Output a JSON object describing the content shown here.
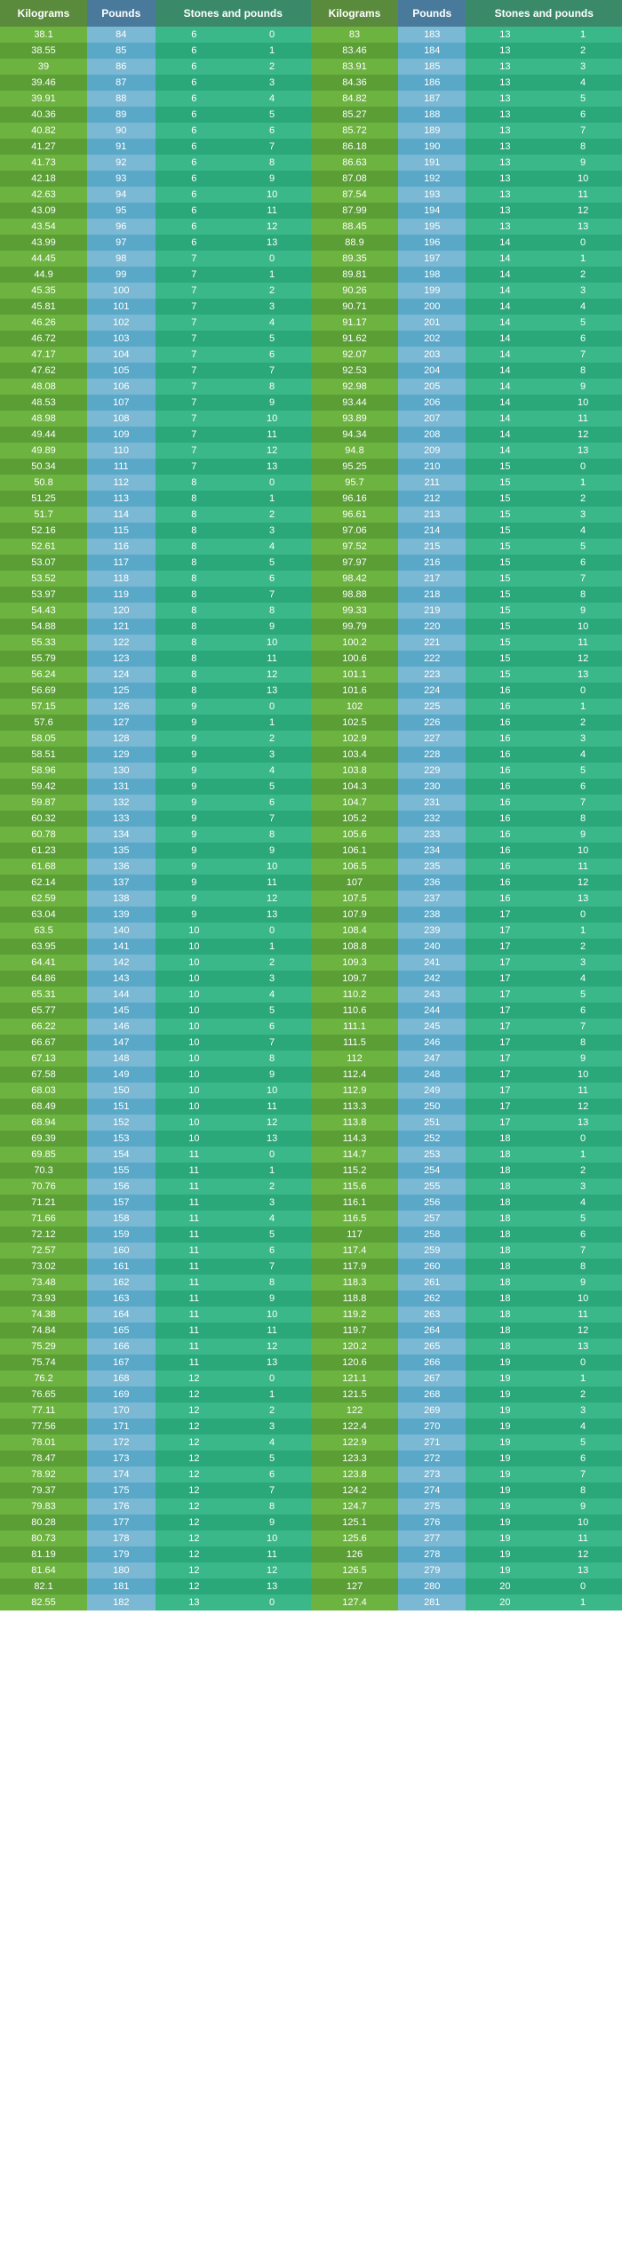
{
  "headers": {
    "kg": "Kilograms",
    "lbs": "Pounds",
    "st": "Stones and pounds"
  },
  "rows": [
    [
      38.1,
      84,
      6,
      0,
      83.0,
      183,
      13,
      1
    ],
    [
      38.55,
      85,
      6,
      1,
      83.46,
      184,
      13,
      2
    ],
    [
      39.0,
      86,
      6,
      2,
      83.91,
      185,
      13,
      3
    ],
    [
      39.46,
      87,
      6,
      3,
      84.36,
      186,
      13,
      4
    ],
    [
      39.91,
      88,
      6,
      4,
      84.82,
      187,
      13,
      5
    ],
    [
      40.36,
      89,
      6,
      5,
      85.27,
      188,
      13,
      6
    ],
    [
      40.82,
      90,
      6,
      6,
      85.72,
      189,
      13,
      7
    ],
    [
      41.27,
      91,
      6,
      7,
      86.18,
      190,
      13,
      8
    ],
    [
      41.73,
      92,
      6,
      8,
      86.63,
      191,
      13,
      9
    ],
    [
      42.18,
      93,
      6,
      9,
      87.08,
      192,
      13,
      10
    ],
    [
      42.63,
      94,
      6,
      10,
      87.54,
      193,
      13,
      11
    ],
    [
      43.09,
      95,
      6,
      11,
      87.99,
      194,
      13,
      12
    ],
    [
      43.54,
      96,
      6,
      12,
      88.45,
      195,
      13,
      13
    ],
    [
      43.99,
      97,
      6,
      13,
      88.9,
      196,
      14,
      0
    ],
    [
      44.45,
      98,
      7,
      0,
      89.35,
      197,
      14,
      1
    ],
    [
      44.9,
      99,
      7,
      1,
      89.81,
      198,
      14,
      2
    ],
    [
      45.35,
      100,
      7,
      2,
      90.26,
      199,
      14,
      3
    ],
    [
      45.81,
      101,
      7,
      3,
      90.71,
      200,
      14,
      4
    ],
    [
      46.26,
      102,
      7,
      4,
      91.17,
      201,
      14,
      5
    ],
    [
      46.72,
      103,
      7,
      5,
      91.62,
      202,
      14,
      6
    ],
    [
      47.17,
      104,
      7,
      6,
      92.07,
      203,
      14,
      7
    ],
    [
      47.62,
      105,
      7,
      7,
      92.53,
      204,
      14,
      8
    ],
    [
      48.08,
      106,
      7,
      8,
      92.98,
      205,
      14,
      9
    ],
    [
      48.53,
      107,
      7,
      9,
      93.44,
      206,
      14,
      10
    ],
    [
      48.98,
      108,
      7,
      10,
      93.89,
      207,
      14,
      11
    ],
    [
      49.44,
      109,
      7,
      11,
      94.34,
      208,
      14,
      12
    ],
    [
      49.89,
      110,
      7,
      12,
      94.8,
      209,
      14,
      13
    ],
    [
      50.34,
      111,
      7,
      13,
      95.25,
      210,
      15,
      0
    ],
    [
      50.8,
      112,
      8,
      0,
      95.7,
      211,
      15,
      1
    ],
    [
      51.25,
      113,
      8,
      1,
      96.16,
      212,
      15,
      2
    ],
    [
      51.7,
      114,
      8,
      2,
      96.61,
      213,
      15,
      3
    ],
    [
      52.16,
      115,
      8,
      3,
      97.06,
      214,
      15,
      4
    ],
    [
      52.61,
      116,
      8,
      4,
      97.52,
      215,
      15,
      5
    ],
    [
      53.07,
      117,
      8,
      5,
      97.97,
      216,
      15,
      6
    ],
    [
      53.52,
      118,
      8,
      6,
      98.42,
      217,
      15,
      7
    ],
    [
      53.97,
      119,
      8,
      7,
      98.88,
      218,
      15,
      8
    ],
    [
      54.43,
      120,
      8,
      8,
      99.33,
      219,
      15,
      9
    ],
    [
      54.88,
      121,
      8,
      9,
      99.79,
      220,
      15,
      10
    ],
    [
      55.33,
      122,
      8,
      10,
      100.2,
      221,
      15,
      11
    ],
    [
      55.79,
      123,
      8,
      11,
      100.6,
      222,
      15,
      12
    ],
    [
      56.24,
      124,
      8,
      12,
      101.1,
      223,
      15,
      13
    ],
    [
      56.69,
      125,
      8,
      13,
      101.6,
      224,
      16,
      0
    ],
    [
      57.15,
      126,
      9,
      0,
      102.0,
      225,
      16,
      1
    ],
    [
      57.6,
      127,
      9,
      1,
      102.5,
      226,
      16,
      2
    ],
    [
      58.05,
      128,
      9,
      2,
      102.9,
      227,
      16,
      3
    ],
    [
      58.51,
      129,
      9,
      3,
      103.4,
      228,
      16,
      4
    ],
    [
      58.96,
      130,
      9,
      4,
      103.8,
      229,
      16,
      5
    ],
    [
      59.42,
      131,
      9,
      5,
      104.3,
      230,
      16,
      6
    ],
    [
      59.87,
      132,
      9,
      6,
      104.7,
      231,
      16,
      7
    ],
    [
      60.32,
      133,
      9,
      7,
      105.2,
      232,
      16,
      8
    ],
    [
      60.78,
      134,
      9,
      8,
      105.6,
      233,
      16,
      9
    ],
    [
      61.23,
      135,
      9,
      9,
      106.1,
      234,
      16,
      10
    ],
    [
      61.68,
      136,
      9,
      10,
      106.5,
      235,
      16,
      11
    ],
    [
      62.14,
      137,
      9,
      11,
      107.0,
      236,
      16,
      12
    ],
    [
      62.59,
      138,
      9,
      12,
      107.5,
      237,
      16,
      13
    ],
    [
      63.04,
      139,
      9,
      13,
      107.9,
      238,
      17,
      0
    ],
    [
      63.5,
      140,
      10,
      0,
      108.4,
      239,
      17,
      1
    ],
    [
      63.95,
      141,
      10,
      1,
      108.8,
      240,
      17,
      2
    ],
    [
      64.41,
      142,
      10,
      2,
      109.3,
      241,
      17,
      3
    ],
    [
      64.86,
      143,
      10,
      3,
      109.7,
      242,
      17,
      4
    ],
    [
      65.31,
      144,
      10,
      4,
      110.2,
      243,
      17,
      5
    ],
    [
      65.77,
      145,
      10,
      5,
      110.6,
      244,
      17,
      6
    ],
    [
      66.22,
      146,
      10,
      6,
      111.1,
      245,
      17,
      7
    ],
    [
      66.67,
      147,
      10,
      7,
      111.5,
      246,
      17,
      8
    ],
    [
      67.13,
      148,
      10,
      8,
      112.0,
      247,
      17,
      9
    ],
    [
      67.58,
      149,
      10,
      9,
      112.4,
      248,
      17,
      10
    ],
    [
      68.03,
      150,
      10,
      10,
      112.9,
      249,
      17,
      11
    ],
    [
      68.49,
      151,
      10,
      11,
      113.3,
      250,
      17,
      12
    ],
    [
      68.94,
      152,
      10,
      12,
      113.8,
      251,
      17,
      13
    ],
    [
      69.39,
      153,
      10,
      13,
      114.3,
      252,
      18,
      0
    ],
    [
      69.85,
      154,
      11,
      0,
      114.7,
      253,
      18,
      1
    ],
    [
      70.3,
      155,
      11,
      1,
      115.2,
      254,
      18,
      2
    ],
    [
      70.76,
      156,
      11,
      2,
      115.6,
      255,
      18,
      3
    ],
    [
      71.21,
      157,
      11,
      3,
      116.1,
      256,
      18,
      4
    ],
    [
      71.66,
      158,
      11,
      4,
      116.5,
      257,
      18,
      5
    ],
    [
      72.12,
      159,
      11,
      5,
      117.0,
      258,
      18,
      6
    ],
    [
      72.57,
      160,
      11,
      6,
      117.4,
      259,
      18,
      7
    ],
    [
      73.02,
      161,
      11,
      7,
      117.9,
      260,
      18,
      8
    ],
    [
      73.48,
      162,
      11,
      8,
      118.3,
      261,
      18,
      9
    ],
    [
      73.93,
      163,
      11,
      9,
      118.8,
      262,
      18,
      10
    ],
    [
      74.38,
      164,
      11,
      10,
      119.2,
      263,
      18,
      11
    ],
    [
      74.84,
      165,
      11,
      11,
      119.7,
      264,
      18,
      12
    ],
    [
      75.29,
      166,
      11,
      12,
      120.2,
      265,
      18,
      13
    ],
    [
      75.74,
      167,
      11,
      13,
      120.6,
      266,
      19,
      0
    ],
    [
      76.2,
      168,
      12,
      0,
      121.1,
      267,
      19,
      1
    ],
    [
      76.65,
      169,
      12,
      1,
      121.5,
      268,
      19,
      2
    ],
    [
      77.11,
      170,
      12,
      2,
      122.0,
      269,
      19,
      3
    ],
    [
      77.56,
      171,
      12,
      3,
      122.4,
      270,
      19,
      4
    ],
    [
      78.01,
      172,
      12,
      4,
      122.9,
      271,
      19,
      5
    ],
    [
      78.47,
      173,
      12,
      5,
      123.3,
      272,
      19,
      6
    ],
    [
      78.92,
      174,
      12,
      6,
      123.8,
      273,
      19,
      7
    ],
    [
      79.37,
      175,
      12,
      7,
      124.2,
      274,
      19,
      8
    ],
    [
      79.83,
      176,
      12,
      8,
      124.7,
      275,
      19,
      9
    ],
    [
      80.28,
      177,
      12,
      9,
      125.1,
      276,
      19,
      10
    ],
    [
      80.73,
      178,
      12,
      10,
      125.6,
      277,
      19,
      11
    ],
    [
      81.19,
      179,
      12,
      11,
      126.0,
      278,
      19,
      12
    ],
    [
      81.64,
      180,
      12,
      12,
      126.5,
      279,
      19,
      13
    ],
    [
      82.1,
      181,
      12,
      13,
      127.0,
      280,
      20,
      0
    ],
    [
      82.55,
      182,
      13,
      0,
      127.4,
      281,
      20,
      1
    ]
  ]
}
